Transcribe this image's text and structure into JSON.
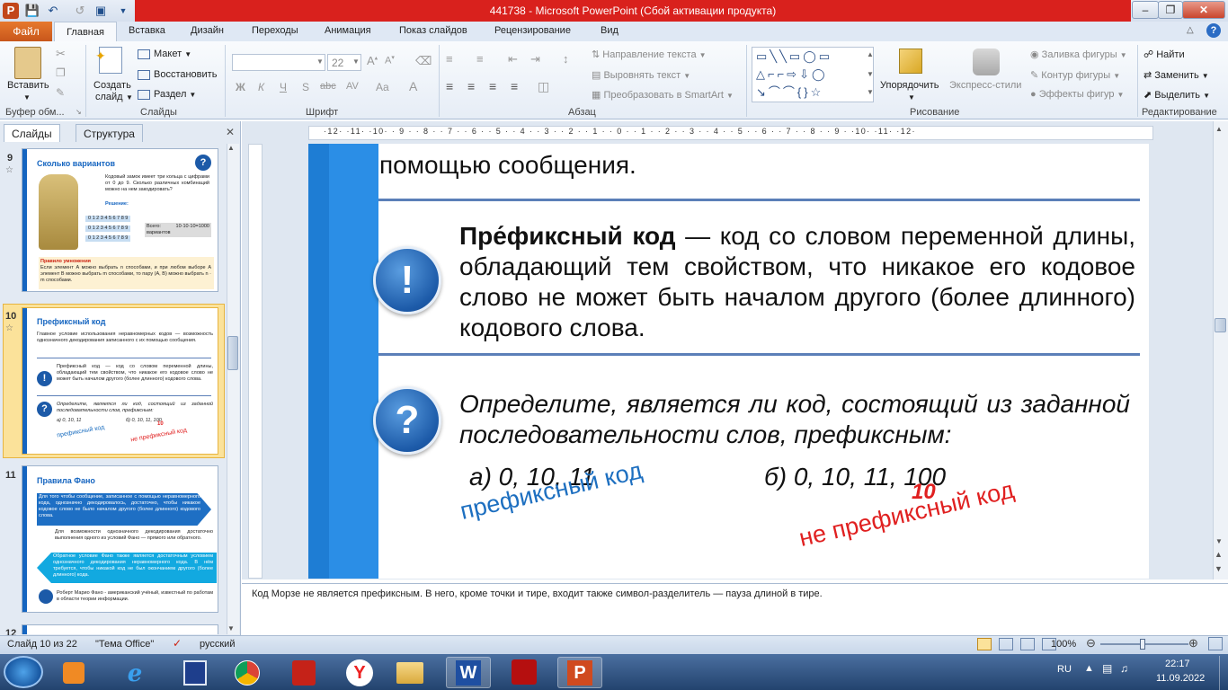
{
  "window": {
    "title": "441738 - Microsoft PowerPoint (Сбой активации продукта)"
  },
  "ribbon": {
    "tabs": [
      "Файл",
      "Главная",
      "Вставка",
      "Дизайн",
      "Переходы",
      "Анимация",
      "Показ слайдов",
      "Рецензирование",
      "Вид"
    ],
    "clipboard": {
      "paste": "Вставить",
      "group": "Буфер обм..."
    },
    "slides": {
      "new_slide_line1": "Создать",
      "new_slide_line2": "слайд",
      "layout": "Макет",
      "reset": "Восстановить",
      "section": "Раздел",
      "group": "Слайды"
    },
    "font": {
      "size": "22",
      "bold": "Ж",
      "italic": "К",
      "underline": "Ч",
      "strike": "S",
      "shadow": "abc",
      "spacing": "AV",
      "case": "Aa",
      "color": "A",
      "group": "Шрифт"
    },
    "paragraph": {
      "text_dir": "Направление текста",
      "align_text": "Выровнять текст",
      "smartart": "Преобразовать в SmartArt",
      "group": "Абзац"
    },
    "drawing": {
      "arrange": "Упорядочить",
      "quick_styles": "Экспресс-стили",
      "fill": "Заливка фигуры",
      "outline": "Контур фигуры",
      "effects": "Эффекты фигур",
      "group": "Рисование"
    },
    "editing": {
      "find": "Найти",
      "replace": "Заменить",
      "select": "Выделить",
      "group": "Редактирование"
    }
  },
  "pane": {
    "tab_slides": "Слайды",
    "tab_outline": "Структура",
    "thumbs": [
      {
        "num": "9",
        "title": "Сколько вариантов",
        "text1": "Кодовый замок имеет три кольца с цифрами от 0 до 9. Сколько различных комбинаций можно на нем закодировать?",
        "solution": "Решение:",
        "digits": "0 1 2 3 4 5 6 7 8 9",
        "total": "Всего: 10·10·10=1000 вариантов",
        "rule": "Правило умножения",
        "rule_text": "Если элемент A можно выбрать n способами, и при любом выборе A элемент B можно выбрать m способами, то пару (A, B) можно выбрать n · m способами."
      },
      {
        "num": "10",
        "title": "Префиксный код",
        "text1": "Главное условие использования неравномерных кодов — возможность однозначного декодирования записанного с их помощью сообщения.",
        "text2": "Префиксный код — код со словом переменной длины, обладающий тем свойством, что никакое его кодовое слово не может быть началом другого (более длинного) кодового слова.",
        "text3": "Определите, является ли код, состоящий из заданной последовательности слов, префиксным:",
        "a": "а) 0, 10, 11",
        "b": "б) 0, 10, 11, 100",
        "pref": "префиксный код",
        "notpref": "не префиксный код",
        "ten": "10"
      },
      {
        "num": "11",
        "title": "Правила Фано",
        "text1": "Для того чтобы сообщение, записанное с помощью неравномерного кода, однозначно декодировалось, достаточно, чтобы никакое кодовое слово не было началом другого (более длинного) кодового слова.",
        "text2": "Для возможности однозначного декодирования достаточно выполнения одного из условий Фано — прямого или обратного.",
        "text3": "Обратное условие Фано также является достаточным условием однозначного декодирования неравномерного кода. В нём требуется, чтобы никакой код не был окончанием другого (более длинного) кода.",
        "text4": "Роберт Марио Фано - американский учёный, известный по работам в области теории информации."
      },
      {
        "num": "12"
      }
    ]
  },
  "ruler": {
    "marks": "·12· ·11· ·10· · 9 · · 8 · · 7 · · 6 · · 5 · · 4 · · 3 · · 2 · · 1 · · 0 · · 1 · · 2 · · 3 · · 4 · · 5 · · 6 · · 7 · · 8 · · 9 · ·10· ·11· ·12·"
  },
  "slide": {
    "top_text": "помощью сообщения.",
    "def_term": "Пре́фиксный код",
    "def_rest": " — код со словом переменной длины, обладающий тем свойством, что никакое его кодовое слово не может быть началом другого (более длинного) кодового слова.",
    "exclaim": "!",
    "question_mark": "?",
    "question": "Определите, является ли код, состоящий из заданной последовательности слов, префиксным:",
    "option_a": "а) 0, 10, 11",
    "option_b": "б) 0, 10, 11, 100",
    "annotation_prefix": "префиксный код",
    "annotation_ten": "10",
    "annotation_not_prefix": "не префиксный код"
  },
  "notes": {
    "text": "Код Морзе не является префиксным. В него, кроме точки и тире, входит также символ-разделитель — пауза длиной в тире."
  },
  "status": {
    "slide": "Слайд 10 из 22",
    "theme": "\"Тема Office\"",
    "lang": "русский",
    "zoom": "100%"
  },
  "taskbar": {
    "lang": "RU",
    "time": "22:17",
    "date": "11.09.2022"
  },
  "colors": {
    "accent": "#1e7dd4",
    "red": "#e02020",
    "blue_annotation": "#1d6fc0"
  }
}
